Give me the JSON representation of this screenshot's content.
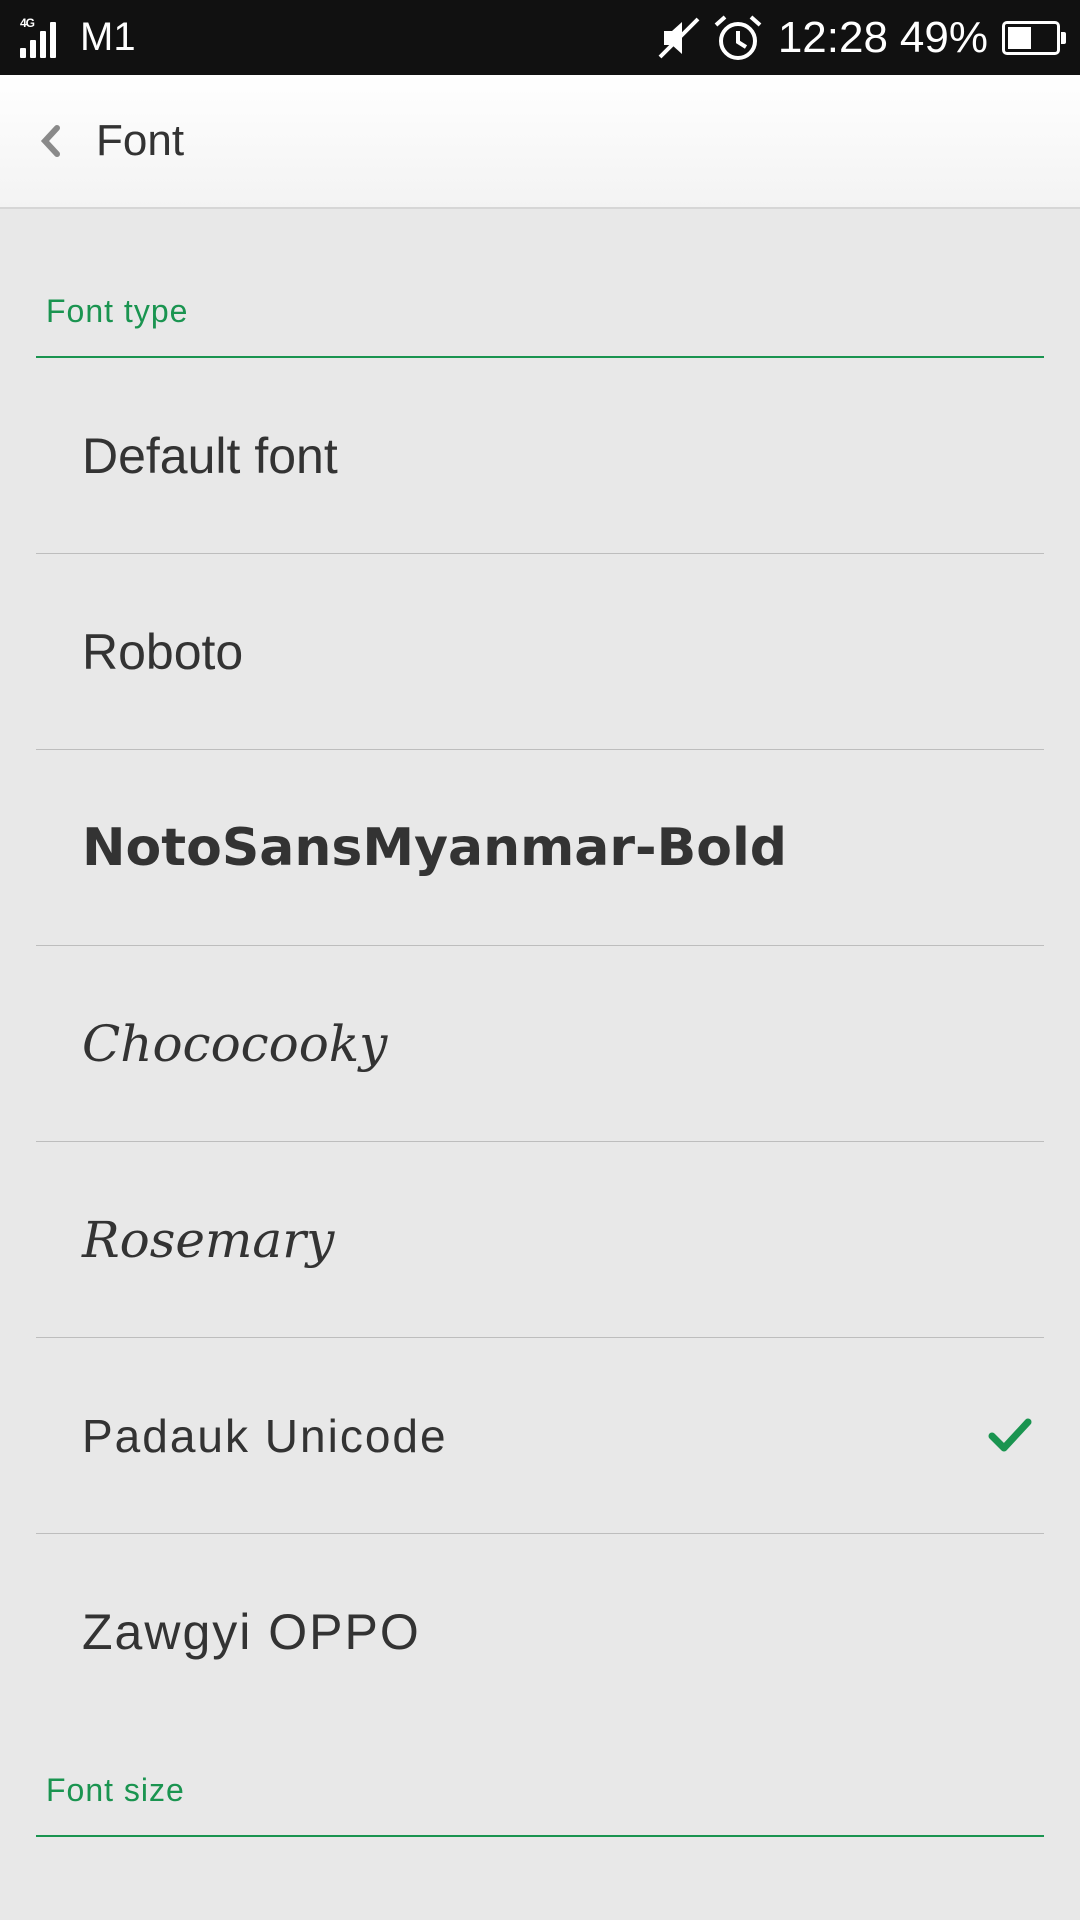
{
  "status_bar": {
    "network": "4G",
    "carrier": "M1",
    "time": "12:28",
    "battery": "49%",
    "battery_level": 0.49,
    "icons": [
      "signal-icon",
      "mute-icon",
      "alarm-icon",
      "battery-icon"
    ]
  },
  "header": {
    "title": "Font",
    "back_icon": "chevron-left-icon"
  },
  "sections": {
    "font_type": "Font type",
    "font_size": "Font size"
  },
  "fonts": [
    {
      "label": "Default font",
      "selected": false
    },
    {
      "label": "Roboto",
      "selected": false
    },
    {
      "label": "NotoSansMyanmar-Bold",
      "selected": false
    },
    {
      "label": "Chococooky",
      "selected": false
    },
    {
      "label": "Rosemary",
      "selected": false
    },
    {
      "label": "Padauk Unicode",
      "selected": true
    },
    {
      "label": "Zawgyi OPPO",
      "selected": false
    }
  ],
  "colors": {
    "accent": "#1a9450",
    "status_bar": "#111111",
    "background": "#e8e8e8",
    "text": "#333333"
  }
}
